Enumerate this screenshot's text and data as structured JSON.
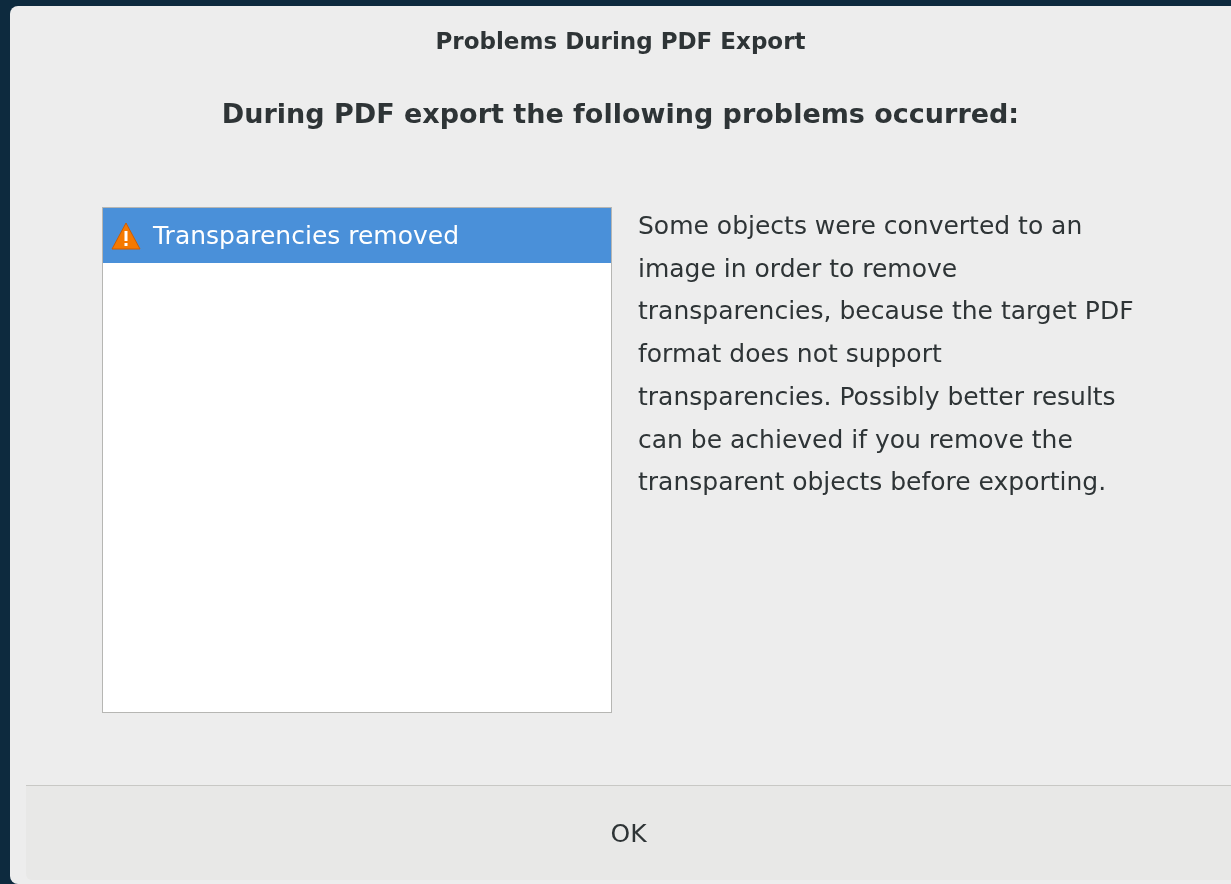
{
  "window": {
    "title": "Problems During PDF Export"
  },
  "heading": "During PDF export the following problems occurred:",
  "problems": [
    {
      "label": "Transparencies removed",
      "kind": "warning",
      "selected": true
    }
  ],
  "description": "Some objects were converted to an image in order to remove transparencies, because the target PDF format does not support transparencies. Possibly better results can be achieved if you remove the transparent objects before exporting.",
  "buttons": [
    "OK"
  ]
}
